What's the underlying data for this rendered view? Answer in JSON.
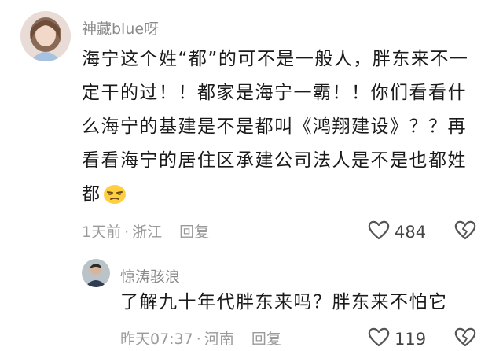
{
  "comments": [
    {
      "username": "神藏blue呀",
      "text": "海宁这个姓“都”的可不是一般人，胖东来不一定干的过！！都家是海宁一霸！！你们看看什么海宁的基建是不是都叫《鸿翔建设》？？再看看海宁的居住区承建公司法人是不是也都姓都",
      "emoji": "smirk-emoji",
      "time": "1天前",
      "location": "浙江",
      "reply_label": "回复",
      "likes": "484",
      "icons": {
        "like": "heart-outline-icon",
        "dislike": "broken-heart-icon"
      }
    },
    {
      "username": "惊涛骇浪",
      "text": "了解九十年代胖东来吗？胖东来不怕它",
      "time": "昨天07:37",
      "location": "河南",
      "reply_label": "回复",
      "likes": "119",
      "icons": {
        "like": "heart-outline-icon",
        "dislike": "broken-heart-icon"
      }
    }
  ],
  "separator": "·"
}
